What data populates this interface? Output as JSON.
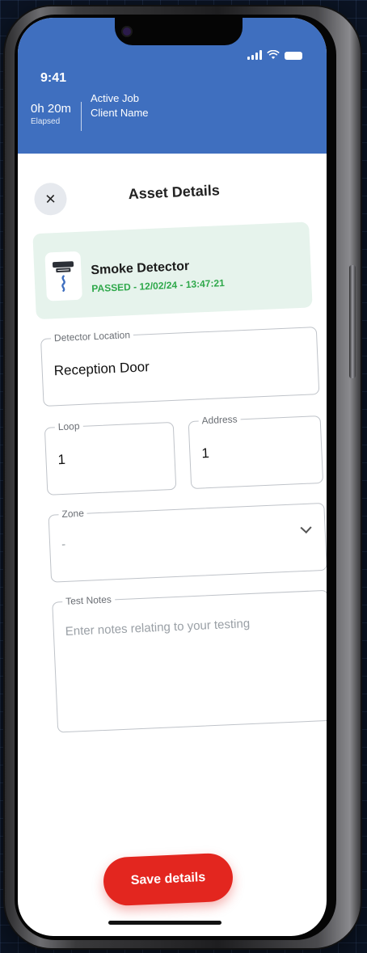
{
  "status_bar": {
    "time": "9:41",
    "icons": [
      "signal-icon",
      "wifi-icon",
      "battery-icon"
    ]
  },
  "header": {
    "elapsed_time": "0h 20m",
    "elapsed_label": "Elapsed",
    "job_status": "Active Job",
    "client_name": "Client Name",
    "background_color": "#3f6fbf"
  },
  "page": {
    "title": "Asset Details",
    "close_icon": "close-icon",
    "close_symbol": "×"
  },
  "asset": {
    "name": "Smoke Detector",
    "status": "PASSED - 12/02/24 - 13:47:21",
    "icon": "smoke-detector-icon",
    "status_color": "#2ea84a",
    "card_color": "#e6f3ec"
  },
  "form": {
    "detector_location": {
      "label": "Detector Location",
      "value": "Reception Door"
    },
    "loop": {
      "label": "Loop",
      "value": "1"
    },
    "address": {
      "label": "Address",
      "value": "1"
    },
    "zone": {
      "label": "Zone",
      "value": "-"
    },
    "test_notes": {
      "label": "Test Notes",
      "placeholder": "Enter notes relating to your testing"
    }
  },
  "actions": {
    "save_label": "Save details",
    "save_color": "#e3261f"
  }
}
